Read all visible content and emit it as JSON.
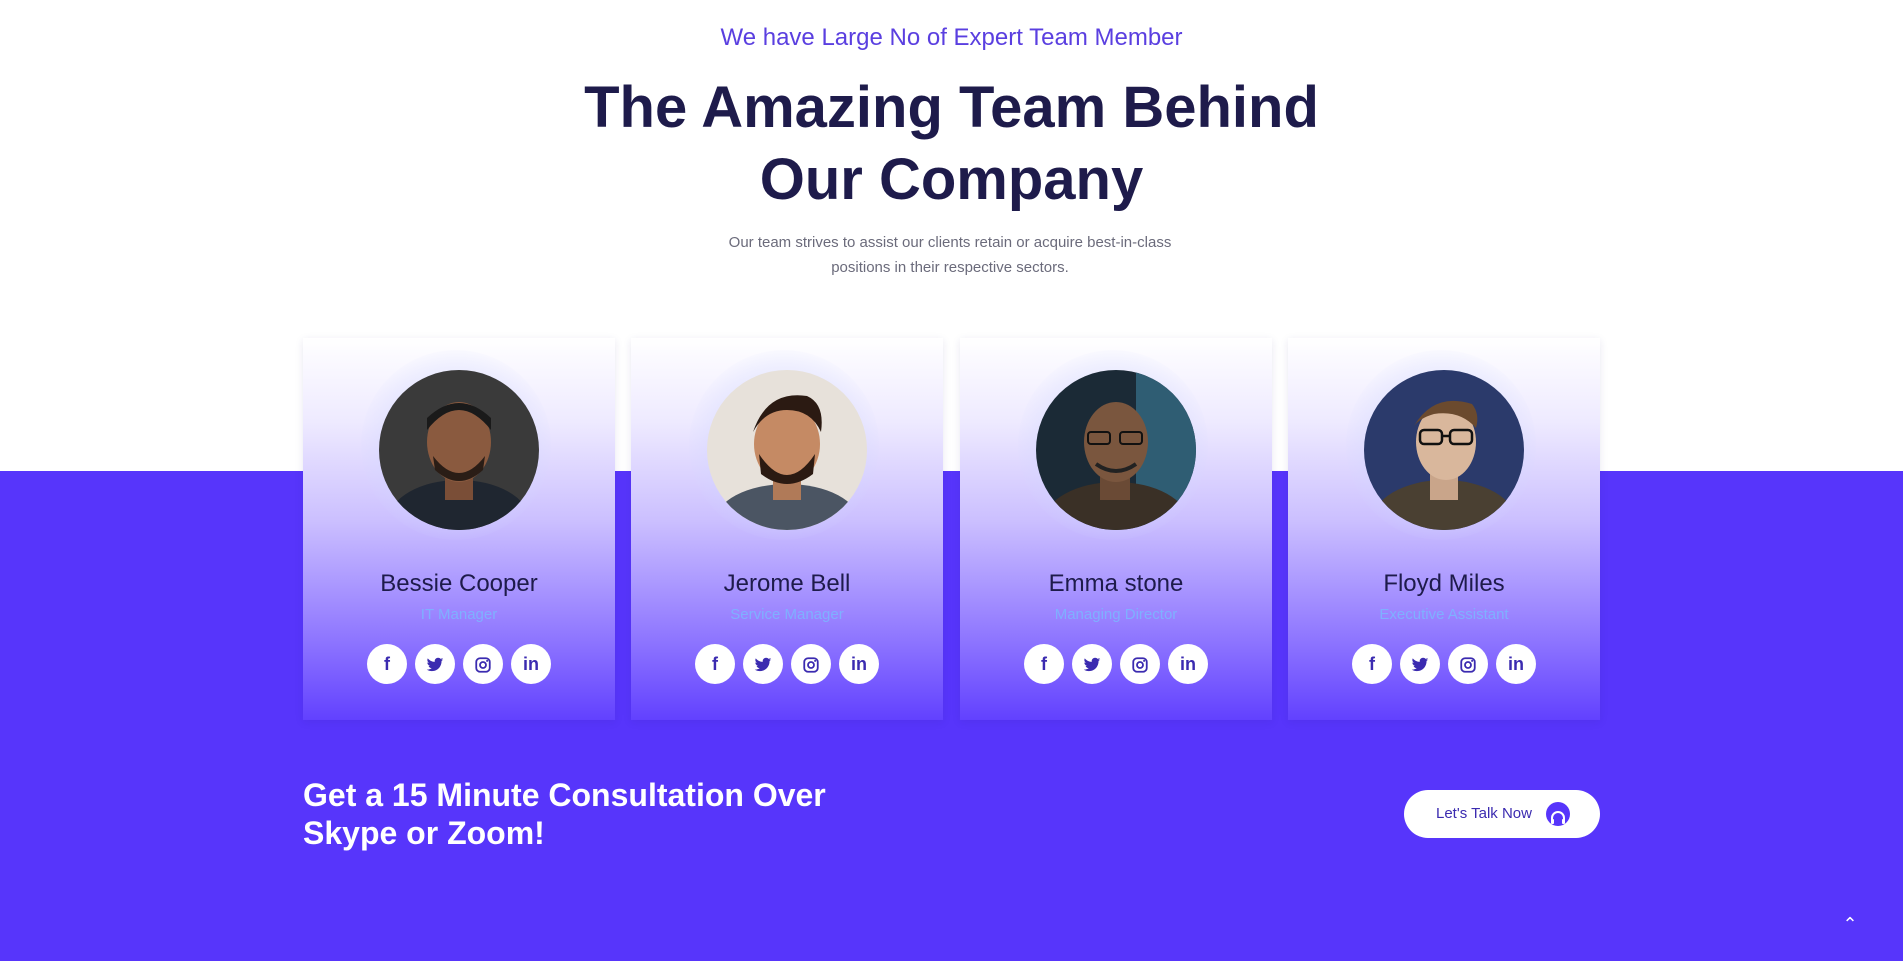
{
  "section": {
    "subtitle": "We have Large No of Expert Team Member",
    "title_line1": "The Amazing Team Behind",
    "title_line2": "Our Company",
    "description_line1": "Our team strives to assist our clients retain or acquire best-in-class",
    "description_line2": "positions in their respective sectors."
  },
  "team": [
    {
      "name": "Bessie Cooper",
      "role": "IT Manager"
    },
    {
      "name": "Jerome Bell",
      "role": "Service Manager"
    },
    {
      "name": "Emma stone",
      "role": "Managing Director"
    },
    {
      "name": "Floyd Miles",
      "role": "Executive Assistant"
    }
  ],
  "social_icons": [
    "facebook-icon",
    "twitter-icon",
    "instagram-icon",
    "linkedin-icon"
  ],
  "cta": {
    "text_line1": "Get a 15 Minute Consultation Over",
    "text_line2": "Skype or Zoom!",
    "button_label": "Let's Talk Now"
  },
  "colors": {
    "accent": "#5735fb",
    "title": "#1e1b4b",
    "subtitle": "#5a3fe0",
    "role": "#7fb0ff"
  }
}
